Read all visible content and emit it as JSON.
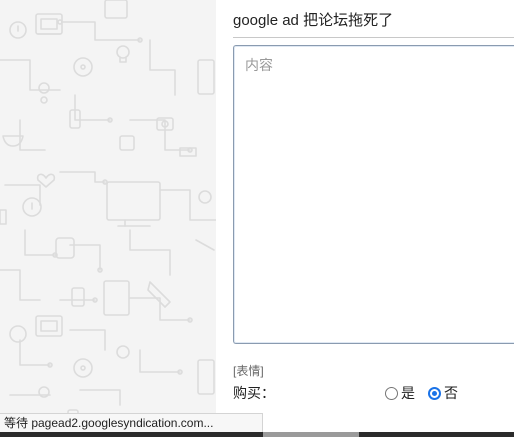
{
  "post": {
    "title": "google ad 把论坛拖死了"
  },
  "content": {
    "placeholder": "内容",
    "value": ""
  },
  "emoji": {
    "label": "[表情]"
  },
  "purchase": {
    "label": "购买：",
    "options": [
      {
        "label": "是",
        "selected": false
      },
      {
        "label": "否",
        "selected": true
      }
    ]
  },
  "status_bar": {
    "text": "等待 pagead2.googlesyndication.com..."
  },
  "colors": {
    "accent": "#1a73e8",
    "pattern_background": "#f4f4f4",
    "pattern_lines": "#dcdcdc"
  }
}
